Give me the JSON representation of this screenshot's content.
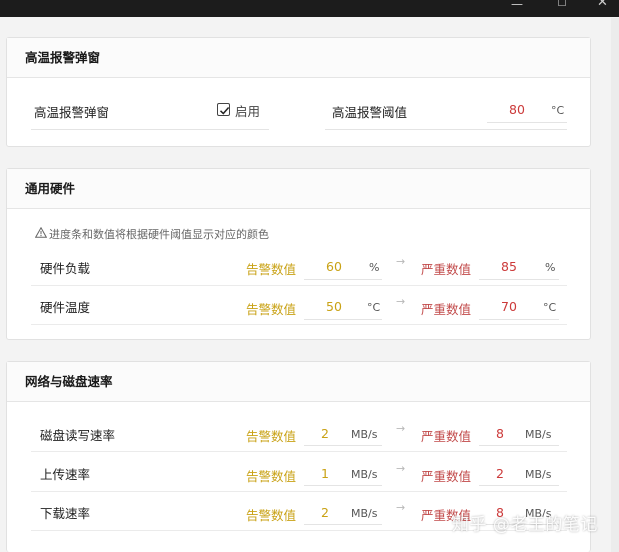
{
  "window": {
    "minimize": "—",
    "maximize": "☐",
    "close": "✕"
  },
  "high_temp": {
    "header": "高温报警弹窗",
    "popup_label": "高温报警弹窗",
    "enable_label": "启用",
    "enabled": true,
    "threshold_label": "高温报警阈值",
    "threshold_value": "80",
    "threshold_unit": "°C"
  },
  "hardware": {
    "header": "通用硬件",
    "hint": "进度条和数值将根据硬件阈值显示对应的颜色",
    "warn_label": "告警数值",
    "crit_label": "严重数值",
    "arrow": "→",
    "rows": [
      {
        "label": "硬件负载",
        "warn": "60",
        "warn_unit": "%",
        "crit": "85",
        "crit_unit": "%"
      },
      {
        "label": "硬件温度",
        "warn": "50",
        "warn_unit": "°C",
        "crit": "70",
        "crit_unit": "°C"
      }
    ]
  },
  "network": {
    "header": "网络与磁盘速率",
    "warn_label": "告警数值",
    "crit_label": "严重数值",
    "arrow": "→",
    "rows": [
      {
        "label": "磁盘读写速率",
        "warn": "2",
        "warn_unit": "MB/s",
        "crit": "8",
        "crit_unit": "MB/s"
      },
      {
        "label": "上传速率",
        "warn": "1",
        "warn_unit": "MB/s",
        "crit": "2",
        "crit_unit": "MB/s"
      },
      {
        "label": "下载速率",
        "warn": "2",
        "warn_unit": "MB/s",
        "crit": "8",
        "crit_unit": "MB/s"
      }
    ]
  },
  "colors": {
    "warn": "#c9a215",
    "crit": "#cc3a3a"
  },
  "watermark": "知乎 @老王的笔记"
}
